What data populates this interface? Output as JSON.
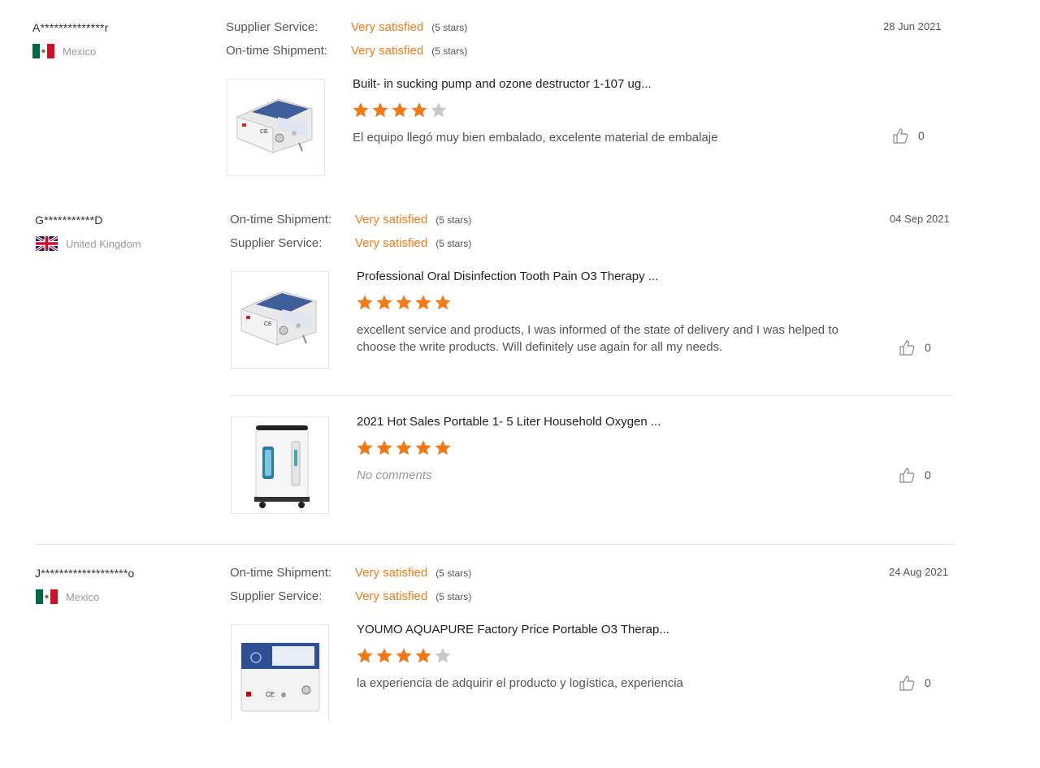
{
  "reviews": [
    {
      "buyer": "A**************r",
      "country": "Mexico",
      "flag": "mexico-flag",
      "date": "28 Jun 2021",
      "ratings": [
        {
          "label": "Supplier Service:",
          "value": "Very satisfied",
          "stars": "(5 stars)"
        },
        {
          "label": "On-time Shipment:",
          "value": "Very satisfied",
          "stars": "(5 stars)"
        }
      ],
      "products": [
        {
          "title": "Built- in sucking pump and ozone destructor 1-107 ug...",
          "stars": 4,
          "comment": "El equipo llegó muy bien embalado, excelente material de embalaje",
          "likes": "0"
        }
      ]
    },
    {
      "buyer": "G***********D",
      "country": "United Kingdom",
      "flag": "uk-flag",
      "date": "04 Sep 2021",
      "ratings": [
        {
          "label": "On-time Shipment:",
          "value": "Very satisfied",
          "stars": "(5 stars)"
        },
        {
          "label": "Supplier Service:",
          "value": "Very satisfied",
          "stars": "(5 stars)"
        }
      ],
      "products": [
        {
          "title": "Professional Oral Disinfection Tooth Pain O3 Therapy ...",
          "stars": 5,
          "comment": "excellent service and products, I was informed of the state of delivery and I was helped to choose the write products. Will definitely use again for all my needs.",
          "likes": "0"
        },
        {
          "title": "2021 Hot Sales Portable 1- 5 Liter Household Oxygen ...",
          "stars": 5,
          "comment": "No comments",
          "likes": "0"
        }
      ]
    },
    {
      "buyer": "J*******************o",
      "country": "Mexico",
      "flag": "mexico-flag",
      "date": "24 Aug 2021",
      "ratings": [
        {
          "label": "On-time Shipment:",
          "value": "Very satisfied",
          "stars": "(5 stars)"
        },
        {
          "label": "Supplier Service:",
          "value": "Very satisfied",
          "stars": "(5 stars)"
        }
      ],
      "products": [
        {
          "title": "YOUMO AQUAPURE Factory Price Portable O3 Therap...",
          "stars": 4,
          "comment": "la experiencia de adquirir el producto y logística, experiencia",
          "likes": "0"
        }
      ]
    }
  ],
  "colors": {
    "accent": "#f47a17",
    "star_off": "#c8c8c8"
  }
}
